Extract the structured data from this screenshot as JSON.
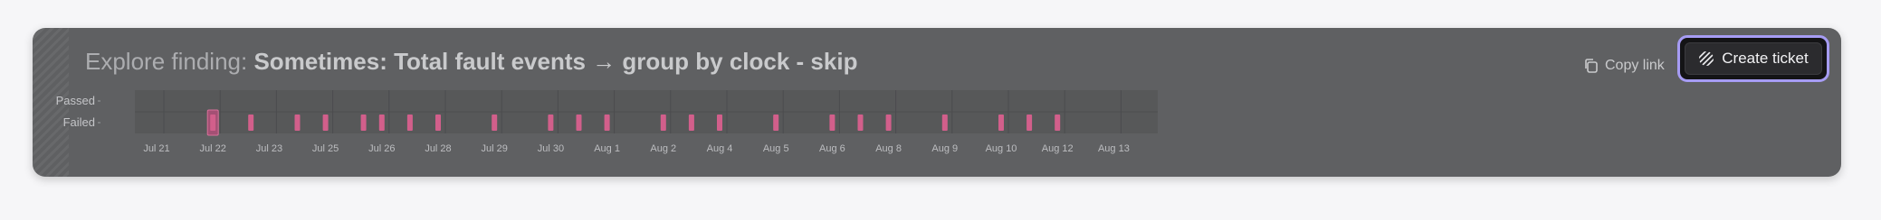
{
  "header": {
    "title_prefix": "Explore finding:",
    "title_main": "Sometimes: Total fault events → group by clock - skip"
  },
  "actions": {
    "copy_link_label": "Copy link",
    "create_ticket_label": "Create ticket"
  },
  "colors": {
    "card_bg": "#5f6062",
    "accent_outline": "#a69cf4",
    "fail_mark": "#d25f8b"
  },
  "icons": {
    "copy": "copy-icon",
    "ticket": "striped-circle-icon"
  },
  "chart_data": {
    "type": "scatter",
    "rows": [
      "Passed",
      "Failed"
    ],
    "x_tick_labels": [
      "Jul 21",
      "Jul 22",
      "Jul 23",
      "Jul 25",
      "Jul 26",
      "Jul 28",
      "Jul 29",
      "Jul 30",
      "Aug 1",
      "Aug 2",
      "Aug 4",
      "Aug 5",
      "Aug 6",
      "Aug 8",
      "Aug 9",
      "Aug 10",
      "Aug 12",
      "Aug 13"
    ],
    "series": [
      {
        "status": "Failed",
        "x": [
          "Jul 22",
          "Jul 22",
          "Jul 24",
          "Jul 25",
          "Jul 25",
          "Jul 26",
          "Jul 27",
          "Jul 28",
          "Jul 29",
          "Jul 30",
          "Jul 31",
          "Aug 1",
          "Aug 2",
          "Aug 3",
          "Aug 4",
          "Aug 5",
          "Aug 6",
          "Aug 7",
          "Aug 8",
          "Aug 9",
          "Aug 10",
          "Aug 11",
          "Aug 12"
        ]
      }
    ],
    "selected_x": "Jul 22",
    "grid": true
  }
}
